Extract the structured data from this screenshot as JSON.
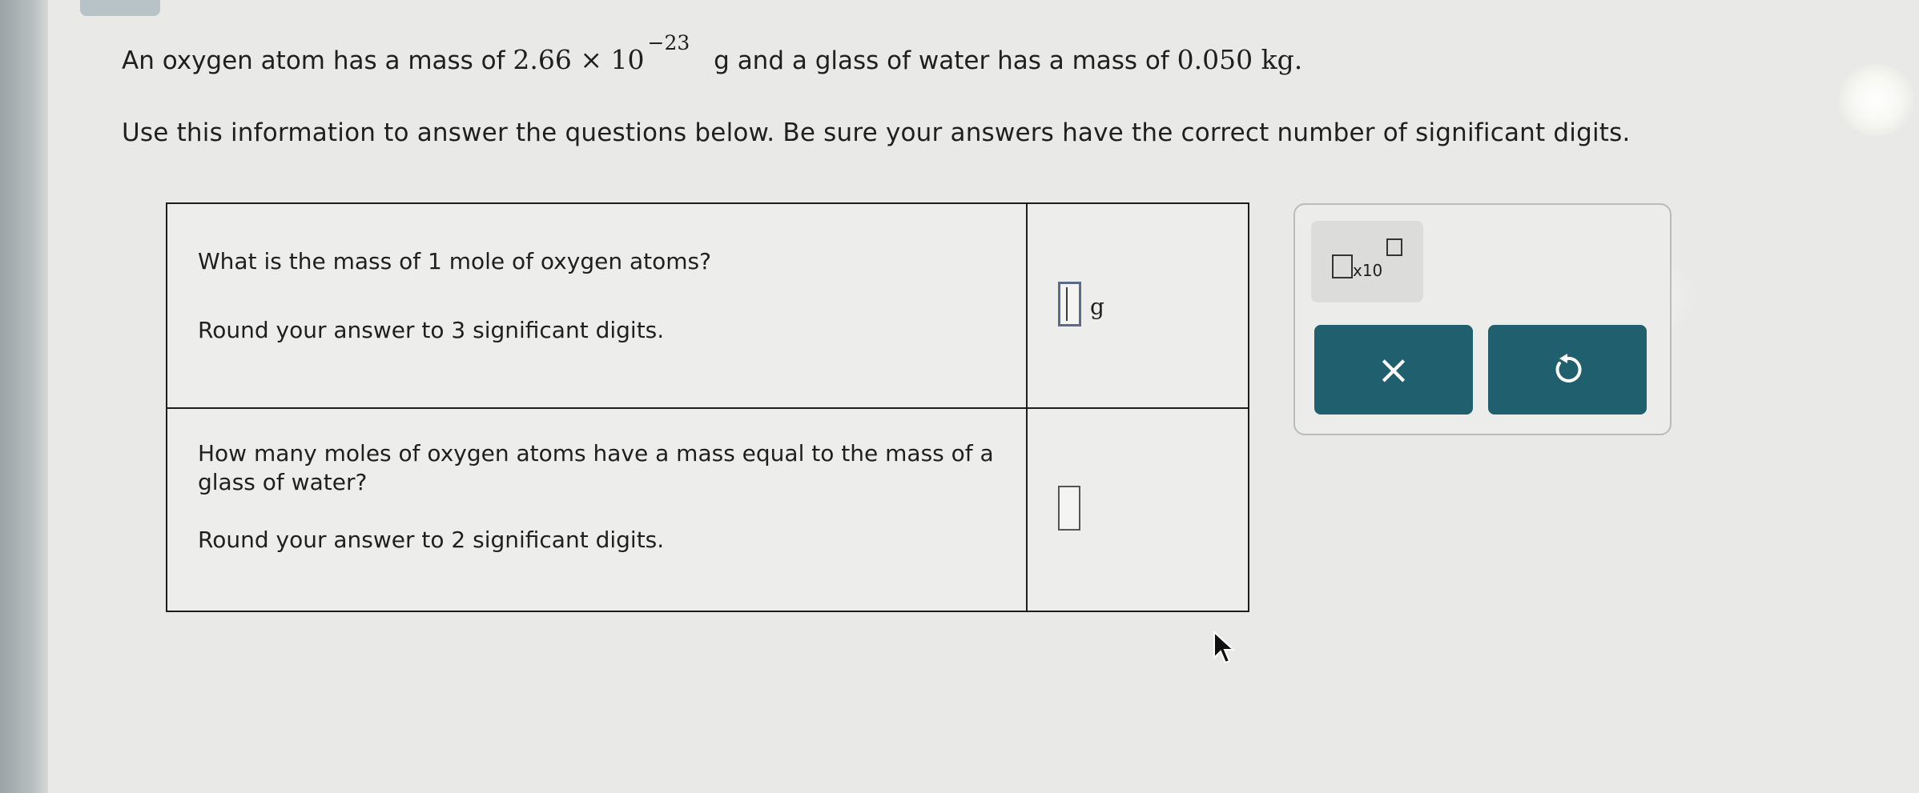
{
  "problem": {
    "line1_a": "An oxygen atom has a mass of",
    "line1_mass": "2.66 × 10",
    "line1_exp": "−23",
    "line1_b": "g and a glass of water has a mass of",
    "line1_water": "0.050 kg.",
    "line2": "Use this information to answer the questions below. Be sure your answers have the correct number of significant digits."
  },
  "questions": [
    {
      "question": "What is the mass of 1 mole of oxygen atoms?",
      "instruction": "Round your answer to 3 significant digits.",
      "answer_value": "",
      "unit": "g"
    },
    {
      "question": "How many moles of oxygen atoms have a mass equal to the mass of a glass of water?",
      "instruction": "Round your answer to 2 significant digits.",
      "answer_value": ""
    }
  ],
  "toolbox": {
    "x10_label": "x10",
    "clear_label": "×",
    "undo_icon": "undo-icon",
    "button_color": "#1f5f6e"
  }
}
